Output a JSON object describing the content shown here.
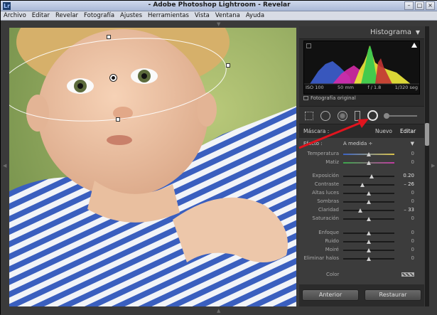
{
  "window": {
    "title": "- Adobe Photoshop Lightroom - Revelar",
    "app_logo": "Lr"
  },
  "menubar": {
    "items": [
      "Archivo",
      "Editar",
      "Revelar",
      "Fotografía",
      "Ajustes",
      "Herramientas",
      "Vista",
      "Ventana",
      "Ayuda"
    ]
  },
  "panel": {
    "histogram": {
      "title": "Histograma",
      "iso": "ISO 100",
      "focal": "50 mm",
      "aperture": "f / 1.8",
      "shutter": "1/320 seg",
      "original_label": "Fotografía original"
    },
    "mask": {
      "label": "Máscara :",
      "new": "Nuevo",
      "edit": "Editar"
    },
    "effect": {
      "label": "Efecto :",
      "value": "A medida ÷"
    },
    "adjustments": [
      {
        "label": "Temperatura",
        "value": "0",
        "pos": 0.5
      },
      {
        "label": "Matiz",
        "value": "0",
        "pos": 0.5
      },
      {
        "label": "Exposición",
        "value": "0.20",
        "pos": 0.55
      },
      {
        "label": "Contraste",
        "value": "– 26",
        "pos": 0.37
      },
      {
        "label": "Altas luces",
        "value": "0",
        "pos": 0.5
      },
      {
        "label": "Sombras",
        "value": "0",
        "pos": 0.5
      },
      {
        "label": "Claridad",
        "value": "– 33",
        "pos": 0.34
      },
      {
        "label": "Saturación",
        "value": "0",
        "pos": 0.5
      },
      {
        "label": "Enfoque",
        "value": "0",
        "pos": 0.5
      },
      {
        "label": "Ruido",
        "value": "0",
        "pos": 0.5
      },
      {
        "label": "Moiré",
        "value": "0",
        "pos": 0.5
      },
      {
        "label": "Eliminar halos",
        "value": "0",
        "pos": 0.5
      }
    ],
    "color_label": "Color",
    "buttons": {
      "previous": "Anterior",
      "reset": "Restaurar"
    }
  },
  "colors": {
    "accent_red": "#e0141e",
    "panel_bg": "#2b2b2b"
  }
}
